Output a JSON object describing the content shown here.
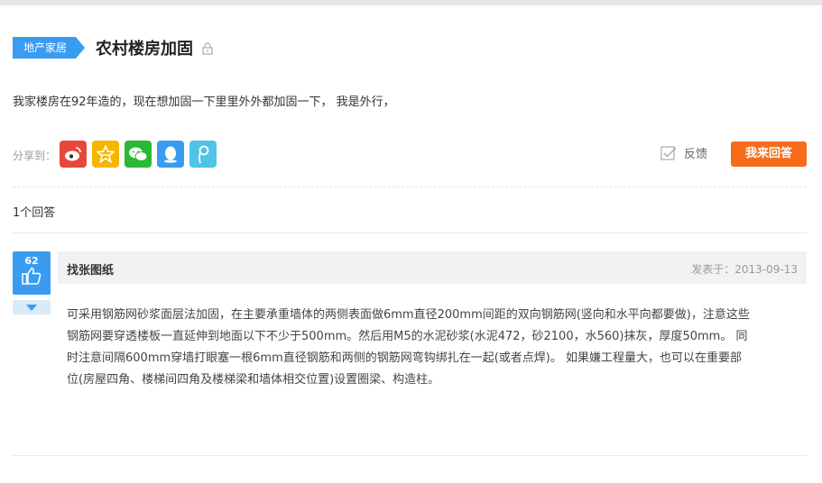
{
  "question": {
    "category_tag": "地产家居",
    "title": "农村楼房加固",
    "body": "我家楼房在92年造的，现在想加固一下里里外外都加固一下， 我是外行，",
    "lock_icon": "lock-icon"
  },
  "share": {
    "label": "分享到：",
    "icons": [
      {
        "name": "weibo-icon",
        "color": "#e8473a"
      },
      {
        "name": "qzone-star-icon",
        "color": "#f7b500"
      },
      {
        "name": "wechat-icon",
        "color": "#29b935"
      },
      {
        "name": "qq-icon",
        "color": "#3a9cf0"
      },
      {
        "name": "tencent-weibo-icon",
        "color": "#4fc3e8"
      }
    ]
  },
  "actions": {
    "feedback_label": "反馈",
    "answer_button_label": "我来回答"
  },
  "answers_count_label": "1个回答",
  "answer": {
    "votes": "62",
    "author": "找张图纸",
    "date": "发表于：2013-09-13",
    "lines": [
      "可采用钢筋网砂浆面层法加固，在主要承重墙体的两侧表面做6mm直径200mm间距的双向钢筋网(竖向和水平向都要做)，注意这些",
      "钢筋网要穿透楼板一直延伸到地面以下不少于500mm。然后用M5的水泥砂浆(水泥472，砂2100，水560)抹灰，厚度50mm。 同",
      "时注意间隔600mm穿墙打眼塞一根6mm直径钢筋和两侧的钢筋网弯钩绑扎在一起(或者点焊)。 如果嫌工程量大，也可以在重要部",
      "位(房屋四角、楼梯间四角及楼梯梁和墙体相交位置)设置圈梁、构造柱。"
    ]
  },
  "colors": {
    "accent_blue": "#3a9cf0",
    "answer_orange": "#f56d1a"
  }
}
